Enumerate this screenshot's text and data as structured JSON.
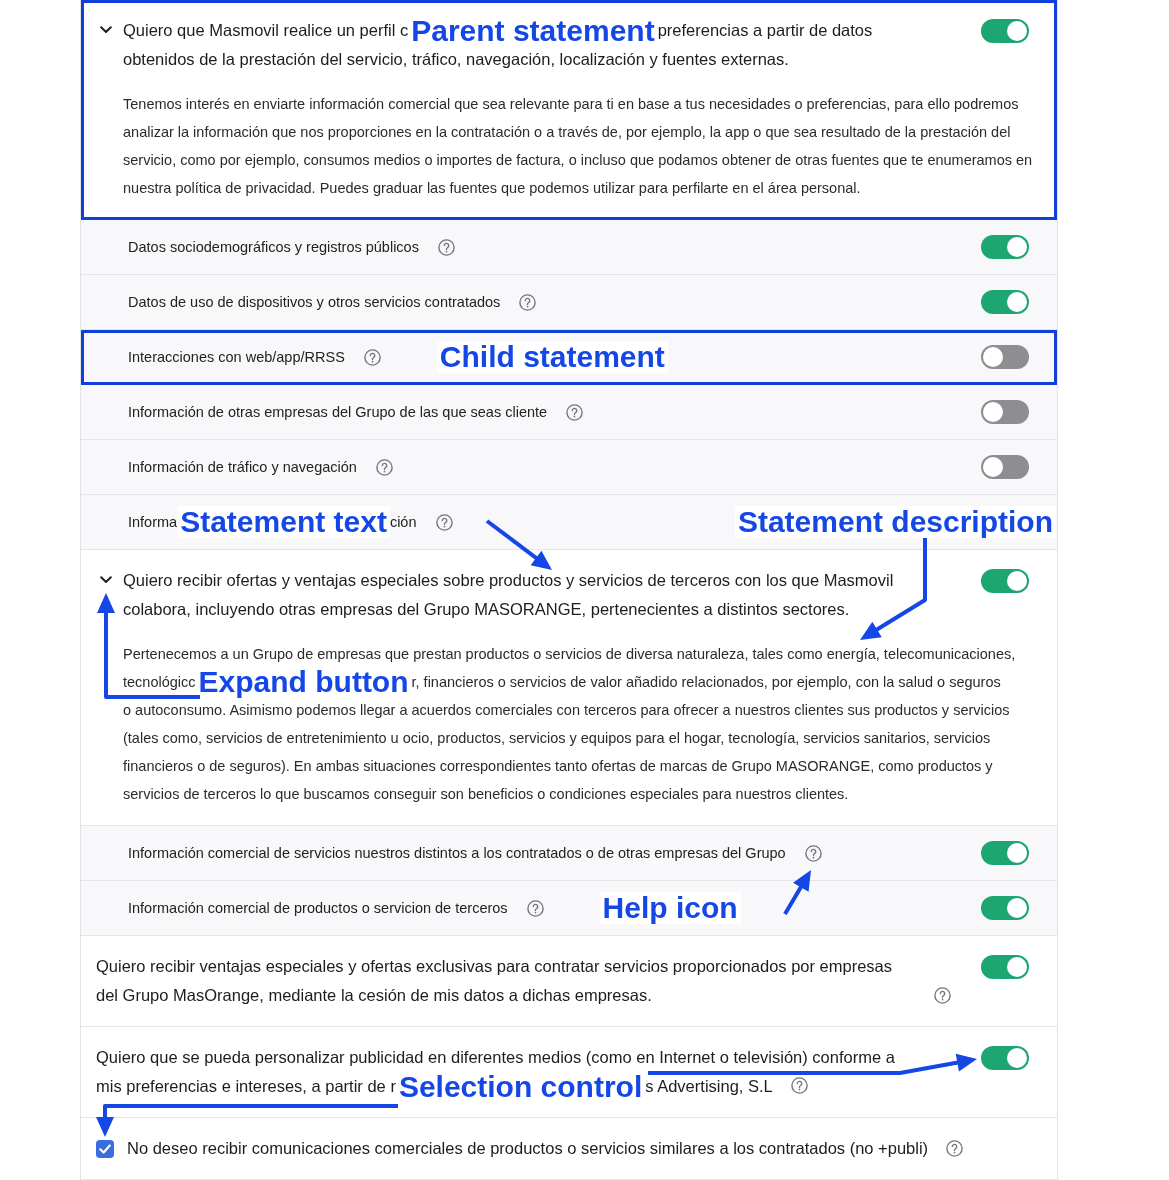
{
  "statements": [
    {
      "kind": "parent",
      "expanded": true,
      "on": true,
      "highlighted": true,
      "title": [
        [
          {
            "kind": "text",
            "text": "Quiero que Masmovil realice un perfil c"
          },
          {
            "kind": "callout",
            "text": "Parent statement"
          },
          {
            "kind": "text",
            "text": "preferencias a partir de datos"
          }
        ],
        [
          {
            "kind": "text",
            "text": "obtenidos de la prestación del servicio, tráfico, navegación, localización y fuentes externas."
          }
        ]
      ],
      "description": [
        [
          {
            "kind": "text",
            "text": "Tenemos interés en enviarte información comercial que sea relevante para ti en base a tus necesidades o preferencias, para ello podremos analizar la información que nos proporciones en la contratación o a través de, por ejemplo, la app o que sea resultado de la prestación del servicio, como por ejemplo, consumos medios o importes de factura, o incluso que podamos obtener de otras fuentes que te enumeramos en nuestra política de privacidad. Puedes graduar las fuentes que podemos utilizar para perfilarte en el área personal."
          }
        ]
      ],
      "children": [
        {
          "label": [
            {
              "kind": "text",
              "text": "Datos sociodemográficos y registros públicos"
            }
          ],
          "on": true,
          "highlighted": false
        },
        {
          "label": [
            {
              "kind": "text",
              "text": "Datos de uso de dispositivos y otros servicios contratados"
            }
          ],
          "on": true,
          "highlighted": false
        },
        {
          "label": [
            {
              "kind": "text",
              "text": "Interacciones con web/app/RRSS"
            }
          ],
          "note": "Child statement",
          "on": false,
          "highlighted": true
        },
        {
          "label": [
            {
              "kind": "text",
              "text": "Información de otras empresas del Grupo de las que seas cliente"
            }
          ],
          "on": false,
          "highlighted": false
        },
        {
          "label": [
            {
              "kind": "text",
              "text": "Información de tráfico y navegación"
            }
          ],
          "on": false,
          "highlighted": false
        },
        {
          "label": [
            {
              "kind": "text",
              "text": "Informa"
            },
            {
              "kind": "callout",
              "text": "Statement text"
            },
            {
              "kind": "text",
              "text": "ción"
            }
          ],
          "trailing_note": "Statement description",
          "highlighted": false
        }
      ]
    },
    {
      "kind": "parent",
      "expanded": true,
      "on": true,
      "highlighted": false,
      "title": [
        [
          {
            "kind": "text",
            "text": "Quiero recibir ofertas y ventajas especiales sobre productos y servicios de terceros con los que Masmovil colabora, incluyendo otras empresas del Grupo MASORANGE, pertenecientes a distintos sectores."
          }
        ]
      ],
      "description": [
        [
          {
            "kind": "text",
            "text": "Pertenecemos a un Grupo de empresas que prestan productos o servicios de diversa naturaleza, tales como energía, telecomunicaciones,"
          }
        ],
        [
          {
            "kind": "text",
            "text": "tecnológicc"
          },
          {
            "kind": "callout",
            "text": "Expand button"
          },
          {
            "kind": "text",
            "text": "r, financieros o servicios de valor añadido relacionados, por ejemplo, con la salud o seguros"
          }
        ],
        [
          {
            "kind": "text",
            "text": "o autoconsumo. Asimismo podemos llegar a acuerdos comerciales con terceros para ofrecer a nuestros clientes sus productos y servicios (tales como, servicios de entretenimiento u ocio, productos, servicios y equipos para el hogar, tecnología, servicios sanitarios, servicios financieros o de seguros). En ambas situaciones correspondientes tanto ofertas de marcas de Grupo MASORANGE, como productos y servicios de terceros lo que buscamos conseguir son beneficios o condiciones especiales para nuestros clientes."
          }
        ]
      ],
      "children": [
        {
          "label": [
            {
              "kind": "text",
              "text": "Información comercial de servicios nuestros distintos a los contratados o de otras empresas del Grupo"
            }
          ],
          "on": true,
          "highlighted": false
        },
        {
          "label": [
            {
              "kind": "text",
              "text": "Información comercial de productos o servicion de terceros"
            }
          ],
          "note": "Help icon",
          "on": true,
          "highlighted": false
        }
      ]
    },
    {
      "kind": "standalone",
      "on": true,
      "highlighted": false,
      "title": [
        [
          {
            "kind": "text",
            "text": "Quiero recibir ventajas especiales y ofertas exclusivas para contratar servicios proporcionados por empresas del Grupo MasOrange, mediante la cesión de mis datos a dichas empresas."
          }
        ]
      ]
    },
    {
      "kind": "standalone",
      "on": true,
      "highlighted": false,
      "title": [
        [
          {
            "kind": "text",
            "text": "Quiero que se pueda personalizar publicidad en diferentes medios (como en Internet o televisión) conforme a"
          }
        ],
        [
          {
            "kind": "text",
            "text": "mis preferencias e intereses, a partir de r"
          },
          {
            "kind": "callout",
            "text": "Selection control"
          },
          {
            "kind": "text",
            "text": "s Advertising, S.L"
          }
        ]
      ]
    },
    {
      "kind": "checkbox",
      "checked": true,
      "highlighted": false,
      "title": [
        [
          {
            "kind": "text",
            "text": "No deseo recibir comunicaciones comerciales de productos o servicios similares a los contratados (no +publi)"
          }
        ]
      ]
    }
  ]
}
